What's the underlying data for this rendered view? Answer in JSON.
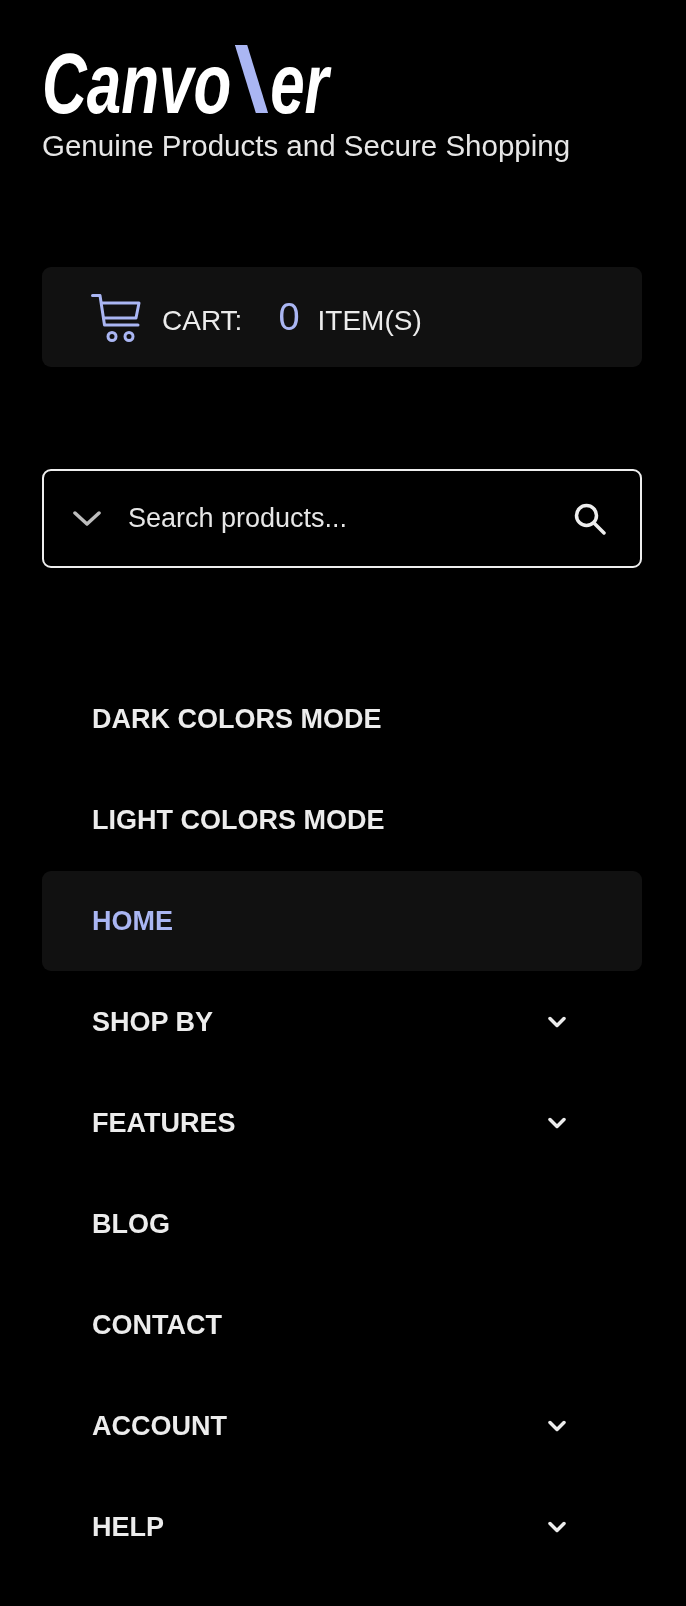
{
  "logo": {
    "lead": "Canvo",
    "tail": "er"
  },
  "tagline": "Genuine Products and Secure Shopping",
  "cart": {
    "label": "CART:",
    "count": "0",
    "unit": "ITEM(S)"
  },
  "search": {
    "placeholder": "Search products..."
  },
  "menu": [
    {
      "label": "DARK COLORS MODE",
      "selected": false,
      "submenu": false
    },
    {
      "label": "LIGHT COLORS MODE",
      "selected": false,
      "submenu": false
    },
    {
      "label": "HOME",
      "selected": true,
      "submenu": false
    },
    {
      "label": "SHOP BY",
      "selected": false,
      "submenu": true
    },
    {
      "label": "FEATURES",
      "selected": false,
      "submenu": true
    },
    {
      "label": "BLOG",
      "selected": false,
      "submenu": false
    },
    {
      "label": "CONTACT",
      "selected": false,
      "submenu": false
    },
    {
      "label": "ACCOUNT",
      "selected": false,
      "submenu": true
    },
    {
      "label": "HELP",
      "selected": false,
      "submenu": true
    }
  ]
}
